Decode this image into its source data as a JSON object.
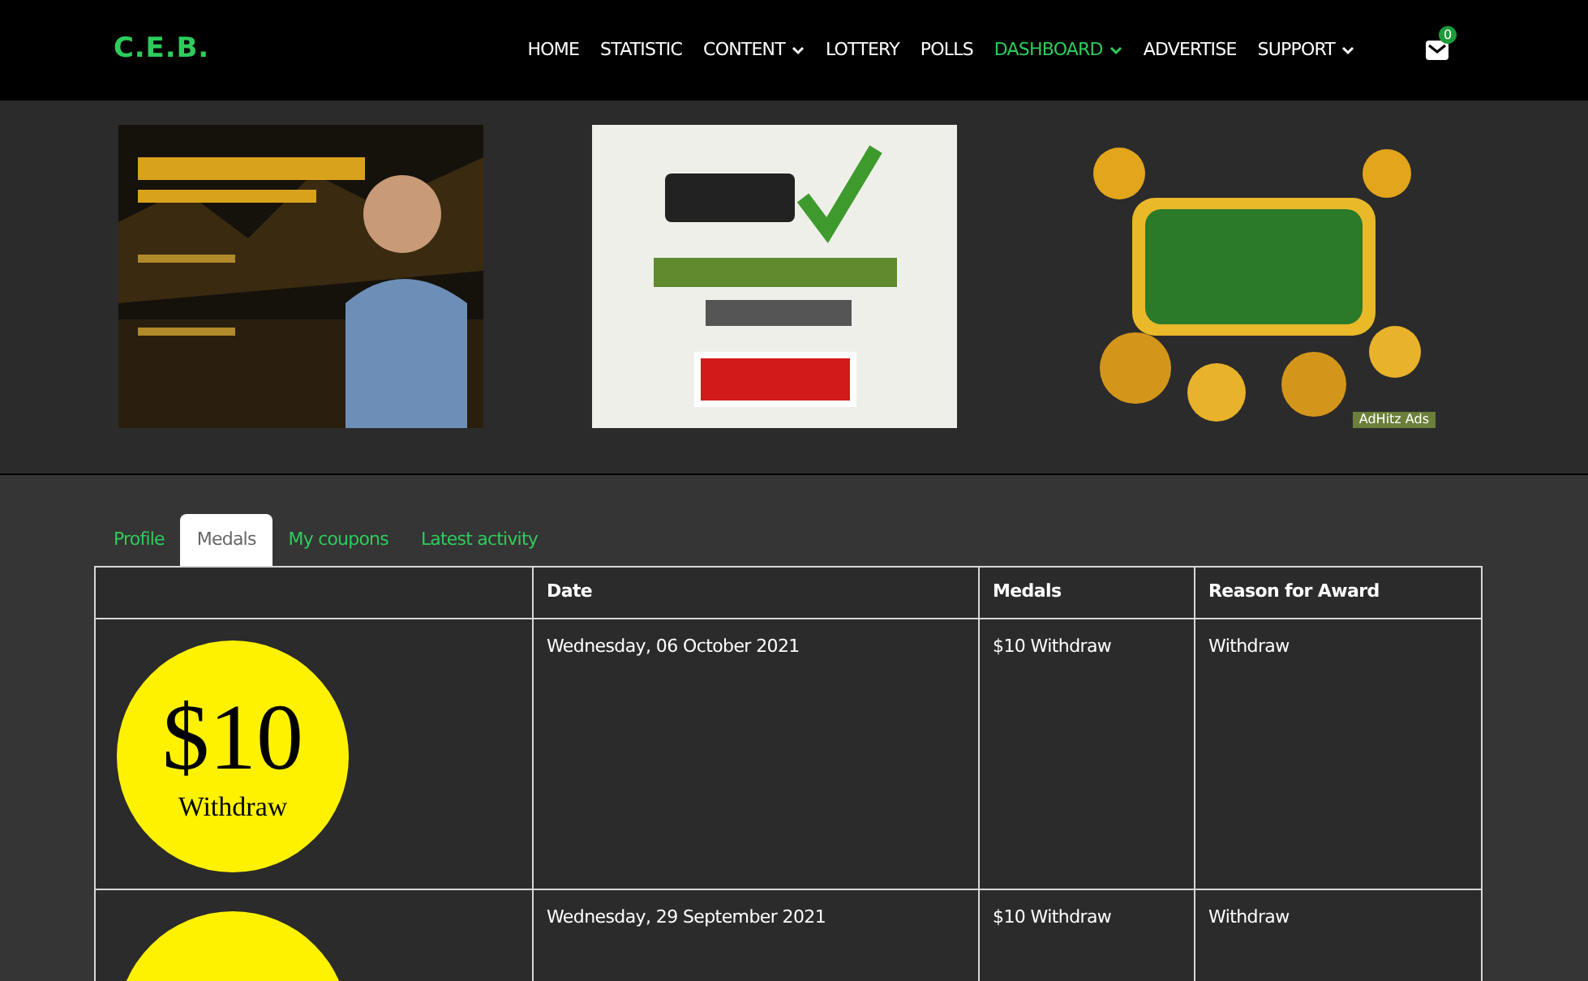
{
  "logo": "C.E.B.",
  "nav": [
    {
      "label": "HOME",
      "dropdown": false,
      "selected": false
    },
    {
      "label": "STATISTIC",
      "dropdown": false,
      "selected": false
    },
    {
      "label": "CONTENT",
      "dropdown": true,
      "selected": false
    },
    {
      "label": "LOTTERY",
      "dropdown": false,
      "selected": false
    },
    {
      "label": "POLLS",
      "dropdown": false,
      "selected": false
    },
    {
      "label": "DASHBOARD",
      "dropdown": true,
      "selected": true
    },
    {
      "label": "ADVERTISE",
      "dropdown": false,
      "selected": false
    },
    {
      "label": "SUPPORT",
      "dropdown": true,
      "selected": false
    }
  ],
  "messages": {
    "count": "0"
  },
  "ads": [
    {
      "kind": "picture"
    },
    {
      "kind": "picture"
    },
    {
      "kind": "picture",
      "label": "AdHitz Ads"
    }
  ],
  "tabs": [
    {
      "label": "Profile",
      "selected": false
    },
    {
      "label": "Medals",
      "selected": true
    },
    {
      "label": "My coupons",
      "selected": false
    },
    {
      "label": "Latest activity",
      "selected": false
    }
  ],
  "table": {
    "columns": [
      "",
      "Date",
      "Medals",
      "Reason for Award"
    ],
    "rows": [
      {
        "medal": {
          "amount": "$10",
          "caption": "Withdraw"
        },
        "date": "Wednesday, 06 October 2021",
        "medals": "$10 Withdraw",
        "reason": "Withdraw"
      },
      {
        "medal": {},
        "date": "Wednesday, 29 September 2021",
        "medals": "$10 Withdraw",
        "reason": "Withdraw"
      }
    ]
  }
}
